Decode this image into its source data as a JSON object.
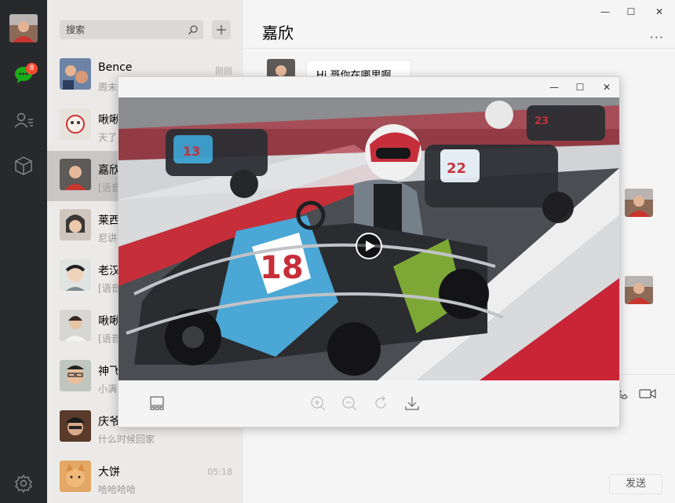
{
  "rail": {
    "badge": "8",
    "icons": [
      "avatar",
      "chat-icon",
      "contacts-icon",
      "favorites-icon",
      "settings-icon"
    ]
  },
  "search": {
    "placeholder": "搜索"
  },
  "chats": [
    {
      "name": "Bence",
      "preview": "周末",
      "time": "刚刚"
    },
    {
      "name": "啾啾",
      "preview": "天了",
      "time": ""
    },
    {
      "name": "嘉欣",
      "preview": "[语音",
      "time": ""
    },
    {
      "name": "莱西",
      "preview": "尼讲",
      "time": ""
    },
    {
      "name": "老汉",
      "preview": "[语音",
      "time": ""
    },
    {
      "name": "啾啾",
      "preview": "[语音",
      "time": ""
    },
    {
      "name": "神飞",
      "preview": "小满",
      "time": ""
    },
    {
      "name": "庆爷",
      "preview": "什么时候回家",
      "time": ""
    },
    {
      "name": "大饼",
      "preview": "哈哈哈哈",
      "time": "05:18"
    }
  ],
  "conversation": {
    "title": "嘉欣",
    "more": "···",
    "message": "Hi 哥你在哪里啊..."
  },
  "composer": {
    "send_label": "发送"
  },
  "window": {
    "minimize": "—",
    "maximize": "☐",
    "close": "✕"
  },
  "viewer": {
    "kart_number_main": "18",
    "kart_number_left": "13",
    "kart_number_right": "22",
    "kart_number_far": "23"
  },
  "colors": {
    "rail": "#28292c",
    "list": "#eceae8",
    "active": "#c9c7c6",
    "badge": "#f74c31",
    "accent": "#1aad19"
  }
}
